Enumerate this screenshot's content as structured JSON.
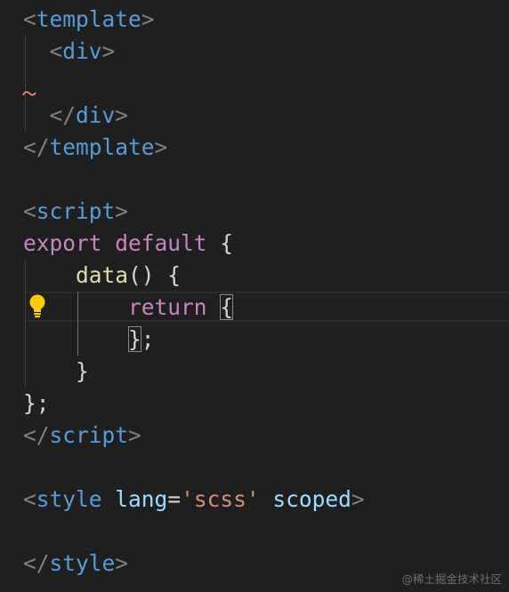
{
  "editor": {
    "language": "vue",
    "lines": {
      "l1": {
        "open": "<",
        "tag": "template",
        "close": ">"
      },
      "l2": {
        "indent": "  ",
        "open": "<",
        "tag": "div",
        "close": ">"
      },
      "l3": {
        "text": ""
      },
      "l4": {
        "indent": "  ",
        "open": "</",
        "tag": "div",
        "close": ">"
      },
      "l5": {
        "open": "</",
        "tag": "template",
        "close": ">"
      },
      "l6": {
        "text": ""
      },
      "l7": {
        "open": "<",
        "tag": "script",
        "close": ">"
      },
      "l8": {
        "kw1": "export",
        "sp": " ",
        "kw2": "default",
        "rest": " {"
      },
      "l9": {
        "indent": "    ",
        "fn": "data",
        "rest": "() {"
      },
      "l10": {
        "indent": "        ",
        "kw": "return",
        "sp": " ",
        "brace": "{"
      },
      "l11": {
        "indent": "        ",
        "brace": "}",
        "rest": ";"
      },
      "l12": {
        "indent": "    ",
        "text": "}"
      },
      "l13": {
        "text": "};"
      },
      "l14": {
        "open": "</",
        "tag": "script",
        "close": ">"
      },
      "l15": {
        "text": ""
      },
      "l16": {
        "open": "<",
        "tag": "style",
        "sp1": " ",
        "attr1": "lang",
        "eq": "=",
        "val": "'scss'",
        "sp2": " ",
        "attr2": "scoped",
        "close": ">"
      },
      "l17": {
        "text": ""
      },
      "l18": {
        "open": "</",
        "tag": "style",
        "close": ">"
      }
    },
    "markers": {
      "error_squiggle_line": 3,
      "lightbulb_line": 10
    },
    "colors": {
      "background": "#1f1f1f",
      "tag": "#569cd6",
      "keyword": "#c586c0",
      "function": "#dcdcaa",
      "attribute": "#9cdcfe",
      "string": "#ce9178",
      "bracket": "#808080",
      "error": "#f48771",
      "lightbulb": "#ffcc00"
    }
  },
  "watermark": {
    "text": "@稀土掘金技术社区"
  }
}
